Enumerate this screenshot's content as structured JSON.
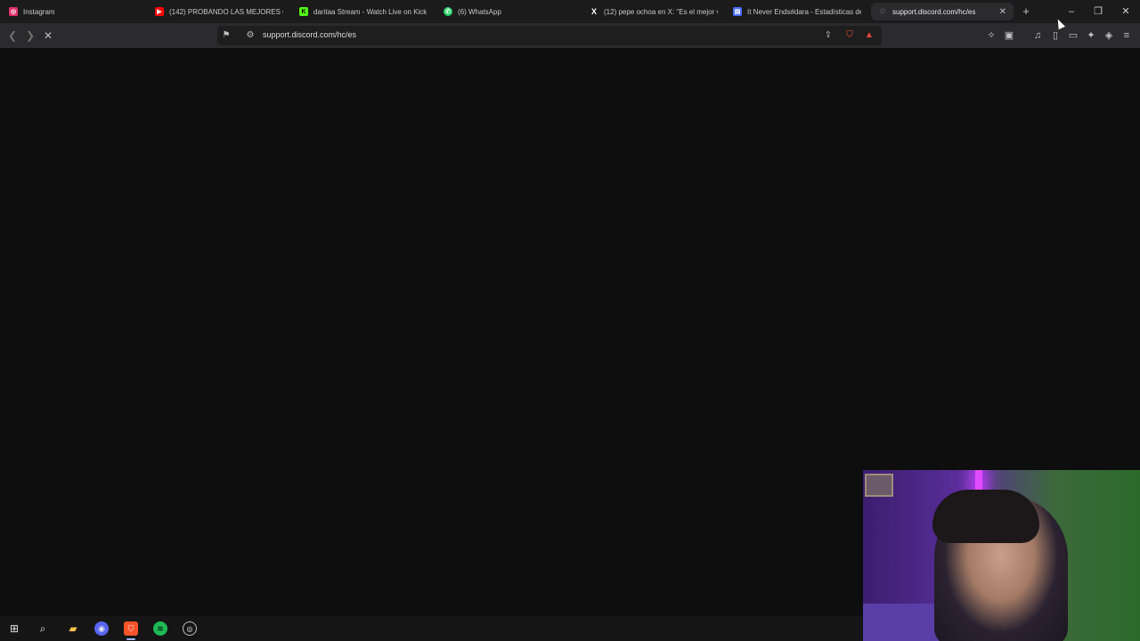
{
  "tabs": [
    {
      "label": "Instagram",
      "icon": "instagram-icon",
      "color": "#e1306c"
    },
    {
      "label": "(142) PROBANDO LAS MEJORES CO",
      "icon": "youtube-icon",
      "color": "#ff0000"
    },
    {
      "label": "daritaa Stream - Watch Live on Kick",
      "icon": "kick-icon",
      "color": "#53fc18"
    },
    {
      "label": "(6) WhatsApp",
      "icon": "whatsapp-icon",
      "color": "#25d366"
    },
    {
      "label": "(12) pepe ochoa en X: \"Es el mejor v",
      "icon": "x-icon",
      "color": "#ffffff"
    },
    {
      "label": "It Never Ends#dara - Estadísticas de",
      "icon": "stats-site-icon",
      "color": "#4a6cf7"
    },
    {
      "label": "support.discord.com/hc/es",
      "icon": "loading-globe-icon",
      "color": "#bdbdbd",
      "active": true
    }
  ],
  "toolbar": {
    "url": "support.discord.com/hc/es"
  },
  "taskbar": {
    "items": [
      "windows-start-icon",
      "search-icon",
      "file-explorer-icon",
      "discord-icon",
      "brave-icon",
      "spotify-icon",
      "obs-icon"
    ]
  },
  "colors": {
    "background": "#0e0e0f",
    "tabstrip": "#1b1b1c",
    "toolbar": "#2b2b2d",
    "brave": "#fb542b"
  }
}
